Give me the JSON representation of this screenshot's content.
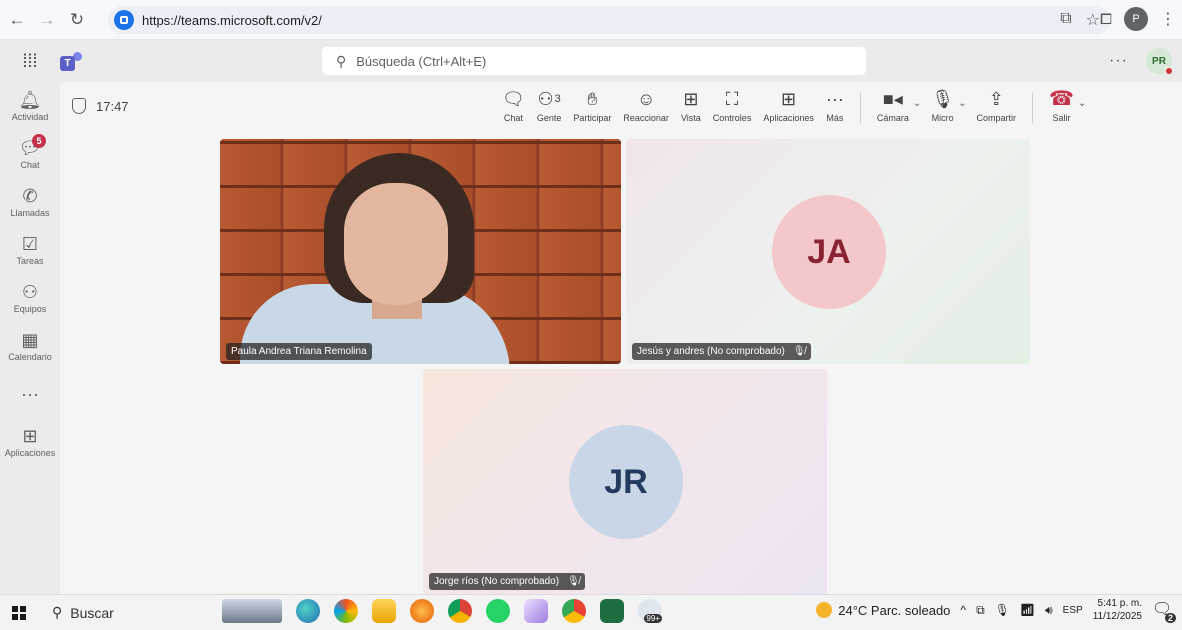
{
  "browser": {
    "url": "https://teams.microsoft.com/v2/",
    "profile_initial": "P"
  },
  "teams_header": {
    "search_placeholder": "Búsqueda (Ctrl+Alt+E)",
    "more": "···",
    "user_initials": "PR"
  },
  "rail": {
    "items": [
      {
        "label": "Actividad",
        "icon": "bell-icon"
      },
      {
        "label": "Chat",
        "icon": "chat-icon",
        "badge": "5"
      },
      {
        "label": "Llamadas",
        "icon": "phone-icon"
      },
      {
        "label": "Tareas",
        "icon": "tasks-icon"
      },
      {
        "label": "Equipos",
        "icon": "teams-icon"
      },
      {
        "label": "Calendario",
        "icon": "calendar-icon"
      },
      {
        "label": "",
        "icon": "more-icon"
      },
      {
        "label": "Aplicaciones",
        "icon": "add-apps-icon"
      }
    ]
  },
  "meeting": {
    "elapsed": "17:47",
    "toolbar": {
      "chat": "Chat",
      "people": "Gente",
      "people_count": "3",
      "raise_hand": "Participar",
      "react": "Reaccionar",
      "view": "Vista",
      "controls": "Controles",
      "apps": "Aplicaciones",
      "more": "Más",
      "camera": "Cámara",
      "mic": "Micro",
      "share": "Compartir",
      "leave": "Salir"
    },
    "participants": [
      {
        "name": "Paula Andrea Triana Remolina",
        "type": "video"
      },
      {
        "name": "Jesús y andres (No comprobado)",
        "initials": "JA",
        "muted": true,
        "avatar_bg": "#f4c7cb",
        "avatar_fg": "#8a2331"
      },
      {
        "name": "Jorge ríos (No comprobado)",
        "initials": "JR",
        "muted": true,
        "avatar_bg": "#c9d6e8",
        "avatar_fg": "#243a5e"
      }
    ]
  },
  "taskbar": {
    "search": "Buscar",
    "weather": "24°C Parc. soleado",
    "language": "ESP",
    "time": "5:41 p. m.",
    "date": "11/12/2025",
    "notifications": "2",
    "badge_99": "99+"
  }
}
